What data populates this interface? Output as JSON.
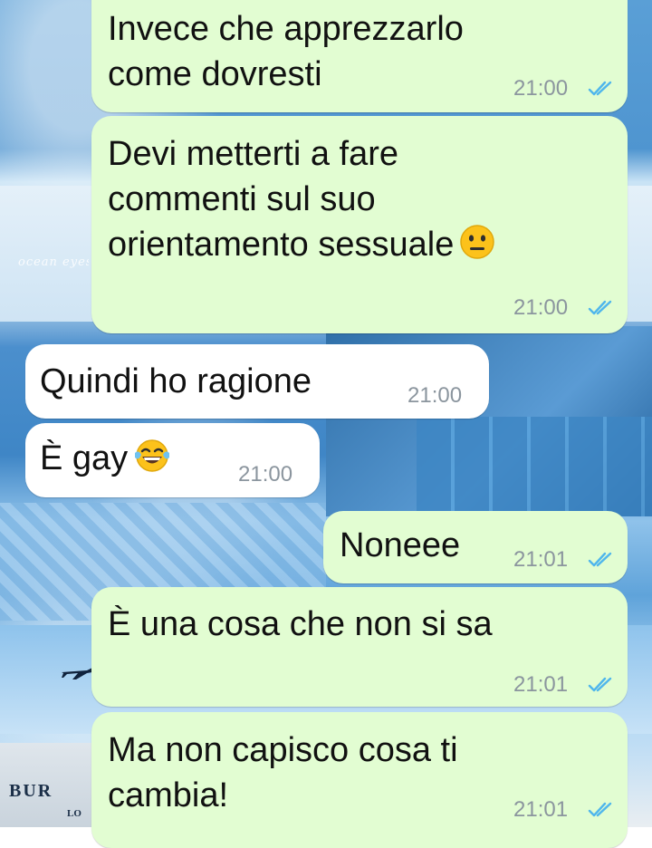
{
  "wallpaper": {
    "caption": "ocean eyes",
    "sign_main": "BUR",
    "sign_sub": "LO"
  },
  "colors": {
    "outgoing_bubble": "#e2fdd2",
    "incoming_bubble": "#ffffff",
    "timestamp": "#8b959e",
    "read_ticks": "#4fb6ec"
  },
  "messages": [
    {
      "direction": "out",
      "lines": [
        "Invece che apprezzarlo",
        "come dovresti"
      ],
      "time": "21:00",
      "status": "read"
    },
    {
      "direction": "out",
      "lines": [
        "Devi metterti a fare",
        "commenti sul suo",
        "orientamento sessuale"
      ],
      "emoji": "neutral-face",
      "time": "21:00",
      "status": "read"
    },
    {
      "direction": "in",
      "lines": [
        "Quindi ho ragione"
      ],
      "time": "21:00"
    },
    {
      "direction": "in",
      "lines": [
        "È gay"
      ],
      "emoji": "face-with-tears-of-joy",
      "time": "21:00"
    },
    {
      "direction": "out",
      "lines": [
        "Noneee"
      ],
      "time": "21:01",
      "status": "read"
    },
    {
      "direction": "out",
      "lines": [
        "È una cosa che non si sa"
      ],
      "time": "21:01",
      "status": "read"
    },
    {
      "direction": "out",
      "lines": [
        "Ma non capisco cosa ti",
        "cambia!"
      ],
      "time": "21:01",
      "status": "read"
    }
  ]
}
